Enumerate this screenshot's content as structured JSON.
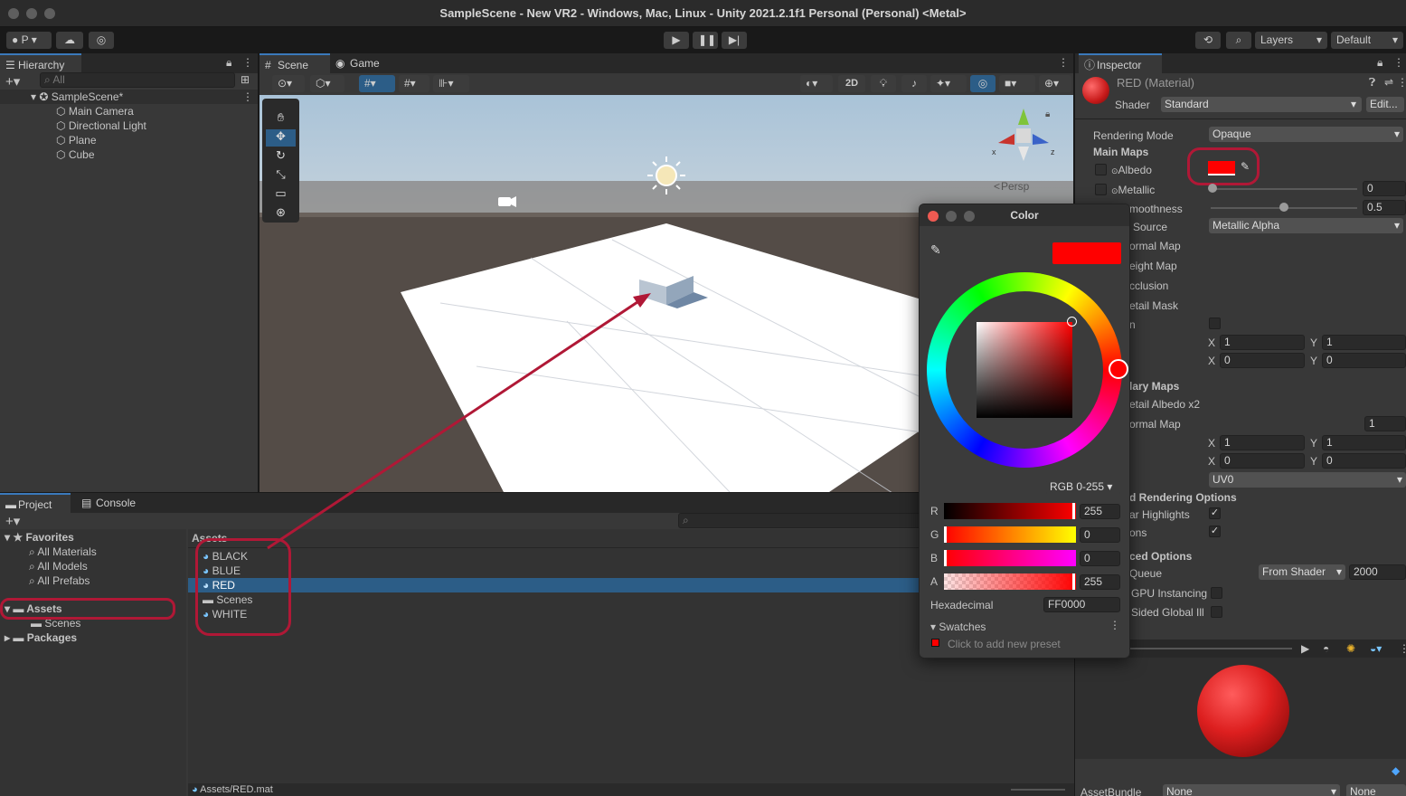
{
  "window": {
    "title": "SampleScene - New VR2 - Windows, Mac, Linux - Unity 2021.2.1f1 Personal (Personal) <Metal>"
  },
  "toolbar": {
    "account": "P",
    "layers": "Layers",
    "layout": "Default"
  },
  "hierarchy": {
    "tab": "Hierarchy",
    "search_placeholder": "All",
    "scene": "SampleScene*",
    "items": [
      "Main Camera",
      "Directional Light",
      "Plane",
      "Cube"
    ]
  },
  "scene_view": {
    "tabs": [
      "Scene",
      "Game"
    ],
    "btn_2d": "2D",
    "persp": "Persp",
    "gizmo_x": "x",
    "gizmo_z": "z"
  },
  "project": {
    "tabs": [
      "Project",
      "Console"
    ],
    "favorites": "Favorites",
    "favorites_items": [
      "All Materials",
      "All Models",
      "All Prefabs"
    ],
    "assets_root": "Assets",
    "assets_children": [
      "Scenes"
    ],
    "packages": "Packages",
    "breadcrumb": "Assets",
    "files": [
      {
        "name": "BLACK",
        "kind": "material"
      },
      {
        "name": "BLUE",
        "kind": "material"
      },
      {
        "name": "RED",
        "kind": "material"
      },
      {
        "name": "Scenes",
        "kind": "folder"
      },
      {
        "name": "WHITE",
        "kind": "material"
      }
    ],
    "selected_file": "RED",
    "status_path": "Assets/RED.mat"
  },
  "color_picker": {
    "title": "Color",
    "current_color": "#FF0000",
    "mode": "RGB 0-255",
    "channels": [
      {
        "label": "R",
        "value": "255"
      },
      {
        "label": "G",
        "value": "0"
      },
      {
        "label": "B",
        "value": "0"
      },
      {
        "label": "A",
        "value": "255"
      }
    ],
    "hex_label": "Hexadecimal",
    "hex_value": "FF0000",
    "swatches_label": "Swatches",
    "swatch_hint": "Click to add new preset"
  },
  "inspector": {
    "tab": "Inspector",
    "material_name": "RED (Material)",
    "shader_label": "Shader",
    "shader_value": "Standard",
    "edit_button": "Edit...",
    "rendering_mode_label": "Rendering Mode",
    "rendering_mode_value": "Opaque",
    "main_maps": "Main Maps",
    "albedo": "Albedo",
    "metallic": "Metallic",
    "metallic_value": "0",
    "smoothness": "moothness",
    "smoothness_value": "0.5",
    "source_label": "Source",
    "source_value": "Metallic Alpha",
    "normal_map": "ormal Map",
    "height_map": "eight Map",
    "occlusion": "cclusion",
    "detail_mask": "etail Mask",
    "emission": "n",
    "tiling_x": "1",
    "tiling_y": "1",
    "offset_x": "0",
    "offset_y": "0",
    "secondary_maps": "lary Maps",
    "detail_albedo": "etail Albedo x2",
    "sec_normal_map": "ormal Map",
    "sec_normal_value": "1",
    "sec_tiling_x": "1",
    "sec_tiling_y": "1",
    "sec_offset_x": "0",
    "sec_offset_y": "0",
    "uv_set": "UV0",
    "forward_options": "d Rendering Options",
    "specular_highlights": "ar Highlights",
    "reflections": "ons",
    "advanced_options": "ced Options",
    "render_queue": "Queue",
    "render_queue_mode": "From Shader",
    "render_queue_value": "2000",
    "gpu_instancing": "GPU Instancing",
    "double_sided": "Sided Global Ill",
    "asset_bundle_label": "AssetBundle",
    "asset_bundle_value": "None",
    "asset_bundle_variant": "None",
    "axis_x": "X",
    "axis_y": "Y"
  },
  "colors": {
    "accent": "#3a79bb",
    "highlight": "#b01836",
    "red": "#ff0000",
    "selection": "#2c5d87"
  }
}
